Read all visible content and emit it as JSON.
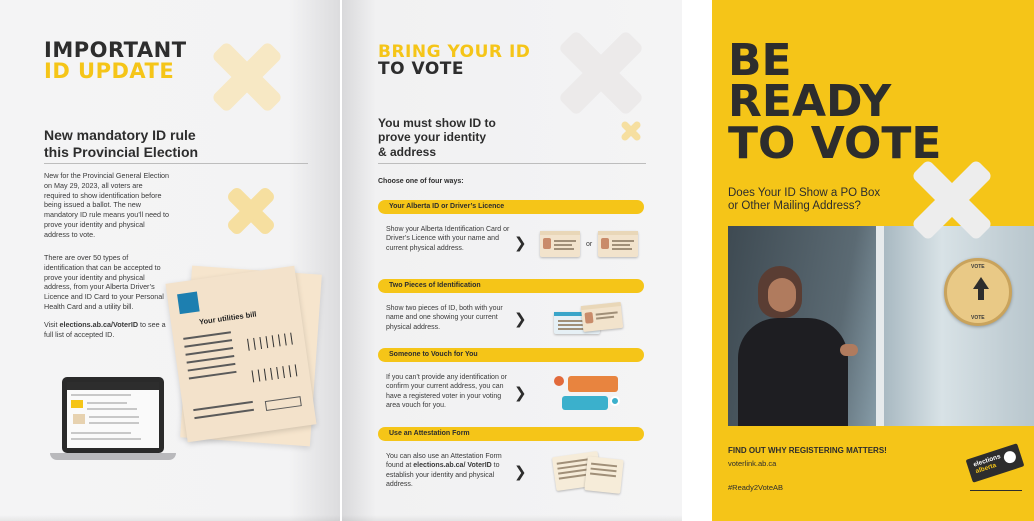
{
  "left_page": {
    "title_line1": "IMPORTANT",
    "title_line2": "ID UPDATE",
    "subtitle_line1": "New mandatory ID rule",
    "subtitle_line2": "this Provincial Election",
    "para1": "New for the Provincial General Election on May 29, 2023, all voters are required to show identification before being issued a ballot. The new mandatory ID rule means you’ll need to prove your identity and physical address to vote.",
    "para2": "There are over 50 types of identification that can be accepted to prove your identity and physical address, from your Alberta Driver’s Licence and ID Card to your Personal Health Card and a utility bill.",
    "para3_prefix": "Visit ",
    "para3_link": "elections.ab.ca/VoterID",
    "para3_suffix": " to see a full list of accepted ID.",
    "bill_title": "Your utilities bill"
  },
  "middle_page": {
    "title_line1": "BRING YOUR ID",
    "title_line2": "TO VOTE",
    "subtitle_line1": "You must show ID to",
    "subtitle_line2": "prove your identity",
    "subtitle_line3": "& address",
    "choose_label": "Choose one of four ways:",
    "or_label": "or",
    "options": [
      {
        "heading": "Your Alberta ID or Driver’s Licence",
        "text": "Show your Alberta Identification Card or Driver’s Licence with your name and current physical address."
      },
      {
        "heading": "Two Pieces of Identification",
        "text": "Show two pieces of ID, both with your name and one showing your current physical address."
      },
      {
        "heading": "Someone to Vouch for You",
        "text": "If you can’t provide any identification or confirm your current address, you can have a registered voter in your voting area vouch for you."
      },
      {
        "heading": "Use an Attestation Form",
        "text_prefix": "You can also use an Attestation Form found at ",
        "text_link": "elections.ab.ca/ VoterID",
        "text_suffix": " to establish your identity and physical address."
      }
    ]
  },
  "cover": {
    "title_line1": "BE",
    "title_line2": "READY",
    "title_line3": "TO VOTE",
    "subtitle_line1": "Does Your ID Show a PO Box",
    "subtitle_line2": "or Other Mailing Address?",
    "sticker_word": "VOTE",
    "cta": "FIND OUT WHY REGISTERING MATTERS!",
    "link": "voterlink.ab.ca",
    "hashtag": "#Ready2VoteAB",
    "logo_line1": "elections",
    "logo_line2": "alberta"
  },
  "colors": {
    "brand_yellow": "#f5c518",
    "text_dark": "#2d2d2d",
    "page_bg": "#f2f2f3"
  },
  "icons": [
    "x-shape-decoration-icon",
    "arrow-right-icon",
    "ballot-box-sticker-icon",
    "elections-alberta-logo-icon"
  ]
}
